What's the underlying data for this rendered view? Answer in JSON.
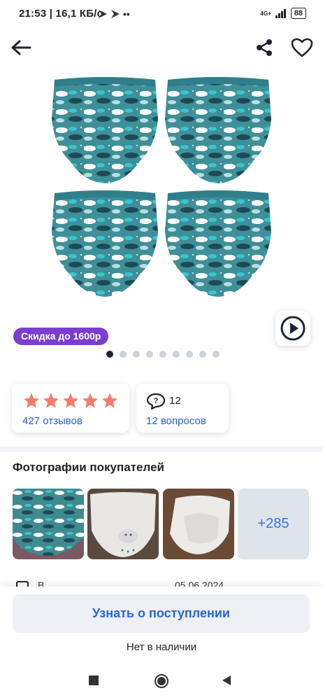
{
  "status_bar": {
    "time_speed": "21:53 | 16,1 КБ/с",
    "network": "4G+",
    "battery": "88"
  },
  "product": {
    "discount_badge": "Скидка до 1600р",
    "gallery_dot_count": 9,
    "gallery_active_index": 0
  },
  "rating_card": {
    "stars": 5,
    "reviews": "427 отзывов"
  },
  "questions_card": {
    "count": "12",
    "label": "12 вопросов"
  },
  "customer_photos": {
    "title": "Фотографии покупателей",
    "more_count": "+285"
  },
  "info_row": {
    "text": "В",
    "date": "05.06.2024"
  },
  "bottom": {
    "notify_button": "Узнать о поступлении",
    "stock_status": "Нет в наличии"
  },
  "colors": {
    "accent_blue": "#2865d8",
    "badge_purple": "#7b3ed1",
    "star_color": "#f47c6a",
    "fabric_teal": "#3f8f98"
  }
}
